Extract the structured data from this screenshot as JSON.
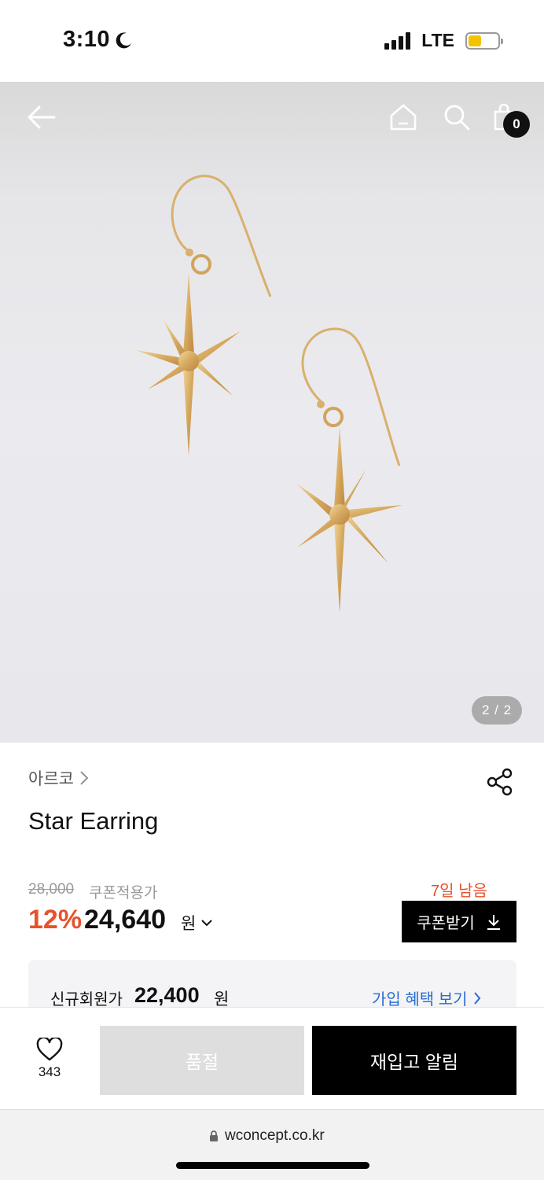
{
  "status_bar": {
    "time": "3:10",
    "network": "LTE"
  },
  "header": {
    "cart_count": "0",
    "icons": [
      "back-arrow-icon",
      "home-icon",
      "search-icon",
      "shopping-bag-icon"
    ]
  },
  "gallery": {
    "page_indicator": "2 / 2",
    "image_subject": "star-earrings"
  },
  "product": {
    "brand": "아르코",
    "title": "Star Earring",
    "original_price": "28,000",
    "coupon_label": "쿠폰적용가",
    "discount_rate": "12%",
    "price": "24,640",
    "currency": "원",
    "coupon_days_left": "7일 남음",
    "coupon_button": "쿠폰받기"
  },
  "member": {
    "label": "신규회원가",
    "price": "22,400",
    "currency": "원",
    "link": "가입 혜택 보기"
  },
  "bottom_bar": {
    "wish_count": "343",
    "soldout_label": "품절",
    "restock_label": "재입고 알림"
  },
  "browser": {
    "url": "wconcept.co.kr"
  },
  "colors": {
    "accent": "#e8512a",
    "link": "#2a6bd1",
    "primary_button": "#000000",
    "disabled_button": "#dedede"
  }
}
